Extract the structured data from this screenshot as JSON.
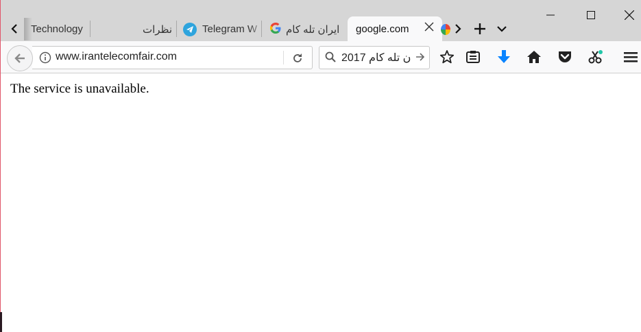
{
  "window": {
    "minimize_label": "Minimize",
    "maximize_label": "Maximize",
    "close_label": "Close"
  },
  "tabs": [
    {
      "title": "Technology",
      "icon": "none"
    },
    {
      "title": "نظرات",
      "icon": "none"
    },
    {
      "title": "Telegram W",
      "icon": "telegram-icon"
    },
    {
      "title": "ایران تله کام",
      "icon": "google-icon"
    },
    {
      "title": "google.com",
      "icon": "none",
      "active": true
    },
    {
      "title": "",
      "icon": "chrome-icon"
    }
  ],
  "navbar": {
    "url": "www.irantelecomfair.com",
    "search_value": "ن تله کام 2017"
  },
  "page": {
    "message": "The service is unavailable."
  },
  "colors": {
    "tabstrip_bg": "#d6d6d6",
    "toolbar_bg": "#f9f9fa",
    "download_blue": "#0a84ff",
    "telegram_blue": "#2ea4dd"
  }
}
